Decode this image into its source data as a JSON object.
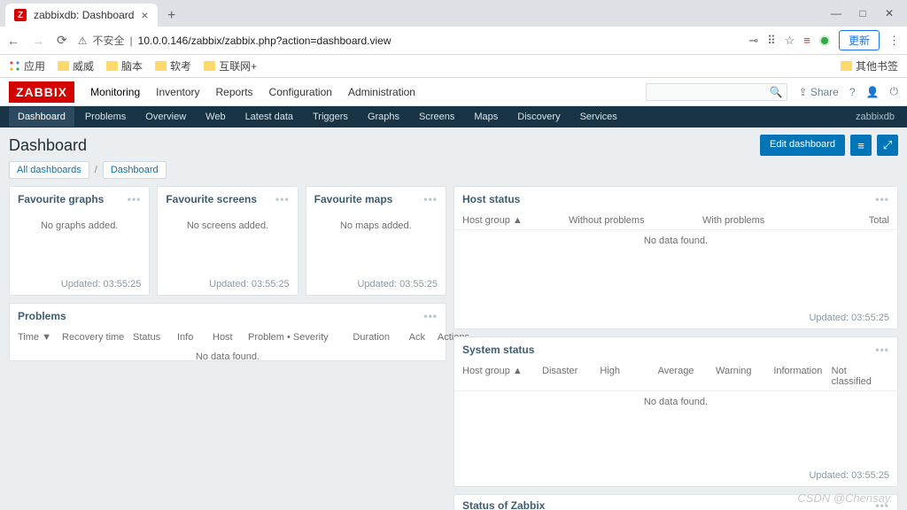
{
  "browser": {
    "tab_title": "zabbixdb: Dashboard",
    "insecure_label": "不安全",
    "url": "10.0.0.146/zabbix/zabbix.php?action=dashboard.view",
    "update_btn": "更新",
    "bookmarks": {
      "apps": "应用",
      "items": [
        "威威",
        "脑本",
        "软考",
        "互联网+"
      ],
      "other": "其他书签"
    }
  },
  "header": {
    "logo": "ZABBIX",
    "menu": [
      "Monitoring",
      "Inventory",
      "Reports",
      "Configuration",
      "Administration"
    ],
    "menu_active": "Monitoring",
    "share": "Share",
    "submenu": [
      "Dashboard",
      "Problems",
      "Overview",
      "Web",
      "Latest data",
      "Triggers",
      "Graphs",
      "Screens",
      "Maps",
      "Discovery",
      "Services"
    ],
    "submenu_active": "Dashboard",
    "host_label": "zabbixdb"
  },
  "page": {
    "title": "Dashboard",
    "edit_btn": "Edit dashboard",
    "breadcrumbs": [
      "All dashboards",
      "Dashboard"
    ]
  },
  "widgets": {
    "fav_graphs": {
      "title": "Favourite graphs",
      "empty": "No graphs added.",
      "updated": "Updated: 03:55:25"
    },
    "fav_screens": {
      "title": "Favourite screens",
      "empty": "No screens added.",
      "updated": "Updated: 03:55:25"
    },
    "fav_maps": {
      "title": "Favourite maps",
      "empty": "No maps added.",
      "updated": "Updated: 03:55:25"
    },
    "problems": {
      "title": "Problems",
      "cols": [
        "Time ▼",
        "Recovery time",
        "Status",
        "Info",
        "Host",
        "Problem • Severity",
        "Duration",
        "Ack",
        "Actions"
      ],
      "empty": "No data found."
    },
    "host_status": {
      "title": "Host status",
      "cols": [
        "Host group ▲",
        "Without problems",
        "With problems",
        "Total"
      ],
      "empty": "No data found.",
      "updated": "Updated: 03:55:25"
    },
    "system_status": {
      "title": "System status",
      "cols": [
        "Host group ▲",
        "Disaster",
        "High",
        "Average",
        "Warning",
        "Information",
        "Not classified"
      ],
      "empty": "No data found.",
      "updated": "Updated: 03:55:25"
    },
    "zabbix_status": {
      "title": "Status of Zabbix"
    }
  },
  "watermark": "CSDN @Chensay."
}
